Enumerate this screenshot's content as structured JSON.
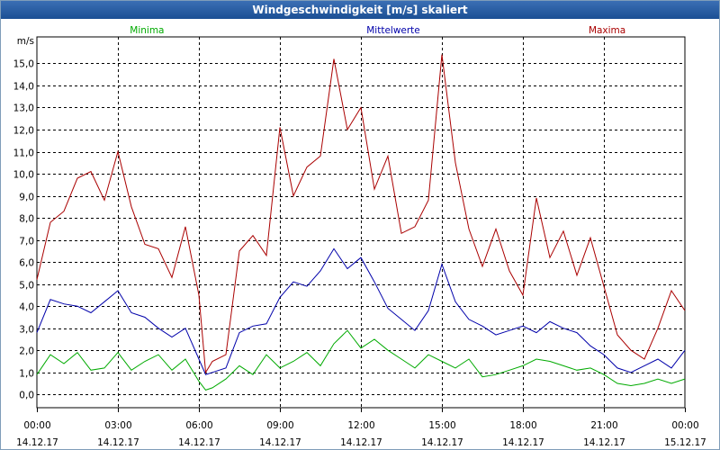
{
  "title": "Windgeschwindigkeit [m/s] skaliert",
  "chart_data": {
    "type": "line",
    "title": "Windgeschwindigkeit [m/s] skaliert",
    "ylabel": "m/s",
    "ylim": [
      -0.6,
      16.2
    ],
    "y_ticks": [
      "0,0",
      "1,0",
      "2,0",
      "3,0",
      "4,0",
      "5,0",
      "6,0",
      "7,0",
      "8,0",
      "9,0",
      "10,0",
      "11,0",
      "12,0",
      "13,0",
      "14,0",
      "15,0"
    ],
    "x_ticks": [
      {
        "time": "00:00",
        "date": "14.12.17"
      },
      {
        "time": "03:00",
        "date": "14.12.17"
      },
      {
        "time": "06:00",
        "date": "14.12.17"
      },
      {
        "time": "09:00",
        "date": "14.12.17"
      },
      {
        "time": "12:00",
        "date": "14.12.17"
      },
      {
        "time": "15:00",
        "date": "14.12.17"
      },
      {
        "time": "18:00",
        "date": "14.12.17"
      },
      {
        "time": "21:00",
        "date": "14.12.17"
      },
      {
        "time": "00:00",
        "date": "15.12.17"
      }
    ],
    "xlim_hours": [
      0,
      24
    ],
    "grid": true,
    "legend_position": "top",
    "series": [
      {
        "name": "Minima",
        "color": "#00aa00",
        "hours": [
          0,
          0.5,
          1,
          1.5,
          2,
          2.5,
          3,
          3.5,
          4,
          4.5,
          5,
          5.5,
          6,
          6.25,
          6.5,
          7,
          7.5,
          8,
          8.5,
          9,
          9.5,
          10,
          10.5,
          11,
          11.5,
          12,
          12.5,
          13,
          13.5,
          14,
          14.5,
          15,
          15.5,
          16,
          16.5,
          17,
          17.5,
          18,
          18.5,
          19,
          19.5,
          20,
          20.5,
          21,
          21.5,
          22,
          22.5,
          23,
          23.5,
          24
        ],
        "values": [
          0.9,
          1.8,
          1.4,
          1.9,
          1.1,
          1.2,
          1.9,
          1.1,
          1.5,
          1.8,
          1.1,
          1.6,
          0.6,
          0.2,
          0.3,
          0.7,
          1.3,
          0.9,
          1.8,
          1.2,
          1.5,
          1.9,
          1.3,
          2.3,
          2.9,
          2.1,
          2.5,
          2.0,
          1.6,
          1.2,
          1.8,
          1.5,
          1.2,
          1.6,
          0.8,
          0.9,
          1.1,
          1.3,
          1.6,
          1.5,
          1.3,
          1.1,
          1.2,
          0.9,
          0.5,
          0.4,
          0.5,
          0.7,
          0.5,
          0.7
        ]
      },
      {
        "name": "Mittelwerte",
        "color": "#0000aa",
        "hours": [
          0,
          0.5,
          1,
          1.5,
          2,
          2.5,
          3,
          3.5,
          4,
          4.5,
          5,
          5.5,
          6,
          6.25,
          6.5,
          7,
          7.5,
          8,
          8.5,
          9,
          9.5,
          10,
          10.5,
          11,
          11.5,
          12,
          12.5,
          13,
          13.5,
          14,
          14.5,
          15,
          15.5,
          16,
          16.5,
          17,
          17.5,
          18,
          18.5,
          19,
          19.5,
          20,
          20.5,
          21,
          21.5,
          22,
          22.5,
          23,
          23.5,
          24
        ],
        "values": [
          2.8,
          4.3,
          4.1,
          4.0,
          3.7,
          4.2,
          4.7,
          3.7,
          3.5,
          3.0,
          2.6,
          3.0,
          1.6,
          0.9,
          1.0,
          1.2,
          2.8,
          3.1,
          3.2,
          4.4,
          5.1,
          4.9,
          5.6,
          6.6,
          5.7,
          6.2,
          5.1,
          3.9,
          3.4,
          2.9,
          3.8,
          5.9,
          4.2,
          3.4,
          3.1,
          2.7,
          2.9,
          3.1,
          2.8,
          3.3,
          3.0,
          2.8,
          2.2,
          1.8,
          1.2,
          1.0,
          1.3,
          1.6,
          1.2,
          2.0
        ]
      },
      {
        "name": "Maxima",
        "color": "#aa0000",
        "hours": [
          0,
          0.5,
          1,
          1.5,
          2,
          2.5,
          3,
          3.5,
          4,
          4.5,
          5,
          5.5,
          6,
          6.25,
          6.5,
          7,
          7.5,
          8,
          8.5,
          9,
          9.5,
          10,
          10.5,
          11,
          11.5,
          12,
          12.5,
          13,
          13.5,
          14,
          14.5,
          15,
          15.5,
          16,
          16.5,
          17,
          17.5,
          18,
          18.5,
          19,
          19.5,
          20,
          20.5,
          21,
          21.5,
          22,
          22.5,
          23,
          23.5,
          24
        ],
        "values": [
          5.2,
          7.8,
          8.3,
          9.8,
          10.1,
          8.8,
          11.0,
          8.5,
          6.8,
          6.6,
          5.3,
          7.6,
          4.5,
          1.0,
          1.5,
          1.8,
          6.5,
          7.2,
          6.3,
          12.1,
          9.0,
          10.3,
          10.8,
          15.2,
          12.0,
          13.0,
          9.3,
          10.8,
          7.3,
          7.6,
          8.8,
          15.4,
          10.5,
          7.5,
          5.8,
          7.5,
          5.6,
          4.5,
          8.9,
          6.2,
          7.4,
          5.4,
          7.1,
          4.9,
          2.7,
          2.0,
          1.6,
          3.0,
          4.7,
          3.8
        ]
      }
    ]
  }
}
